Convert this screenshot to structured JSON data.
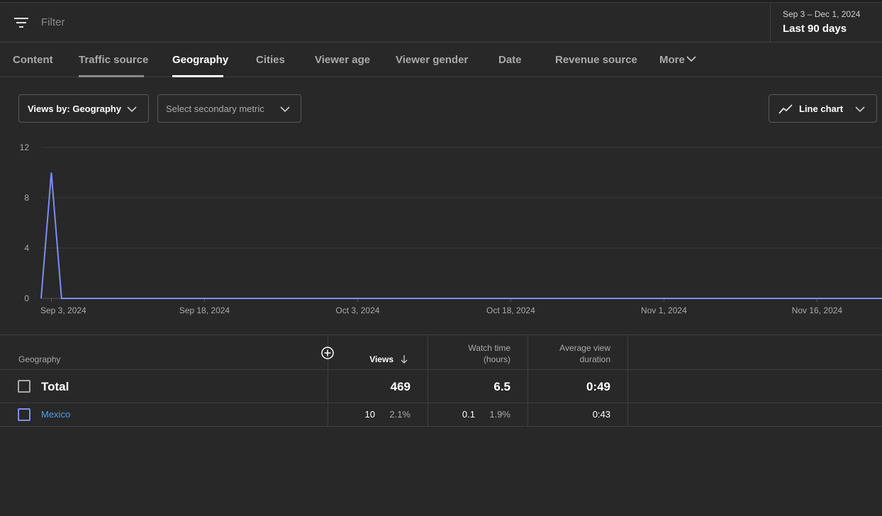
{
  "filter": {
    "placeholder": "Filter",
    "icon": "filter-icon"
  },
  "date": {
    "range": "Sep 3 – Dec 1, 2024",
    "preset": "Last 90 days"
  },
  "tabs": [
    {
      "label": "Content"
    },
    {
      "label": "Traffic source"
    },
    {
      "label": "Geography"
    },
    {
      "label": "Cities"
    },
    {
      "label": "Viewer age"
    },
    {
      "label": "Viewer gender"
    },
    {
      "label": "Date"
    },
    {
      "label": "Revenue source"
    },
    {
      "label": "More"
    }
  ],
  "active_tab": "Geography",
  "controls": {
    "primary_metric": "Views by: Geography",
    "secondary_metric": "Select secondary metric",
    "chart_type": "Line chart"
  },
  "chart_data": {
    "type": "line",
    "title": "",
    "xlabel": "",
    "ylabel": "",
    "x": [
      "2024-09-02",
      "2024-09-03",
      "2024-09-04",
      "2024-12-01"
    ],
    "series": [
      {
        "name": "Mexico",
        "values": [
          0,
          10,
          0,
          0
        ]
      }
    ],
    "ylim": [
      0,
      12
    ],
    "yticks": [
      0,
      4,
      8,
      12
    ],
    "xtick_labels": [
      "Sep 3, 2024",
      "Sep 18, 2024",
      "Oct 3, 2024",
      "Oct 18, 2024",
      "Nov 1, 2024",
      "Nov 16, 2024"
    ],
    "grid": true,
    "line_color": "#7b8ff4"
  },
  "table": {
    "columns": {
      "geography": "Geography",
      "views": "Views",
      "watch_time_line1": "Watch time",
      "watch_time_line2": "(hours)",
      "avg_line1": "Average view",
      "avg_line2": "duration"
    },
    "total": {
      "label": "Total",
      "views": "469",
      "watch_time": "6.5",
      "avg_duration": "0:49"
    },
    "rows": [
      {
        "name": "Mexico",
        "views": "10",
        "views_pct": "2.1%",
        "watch_time": "0.1",
        "watch_time_pct": "1.9%",
        "avg_duration": "0:43"
      }
    ]
  },
  "colors": {
    "background": "#282828",
    "accent": "#3ea6ff",
    "series": "#7b8ff4"
  }
}
